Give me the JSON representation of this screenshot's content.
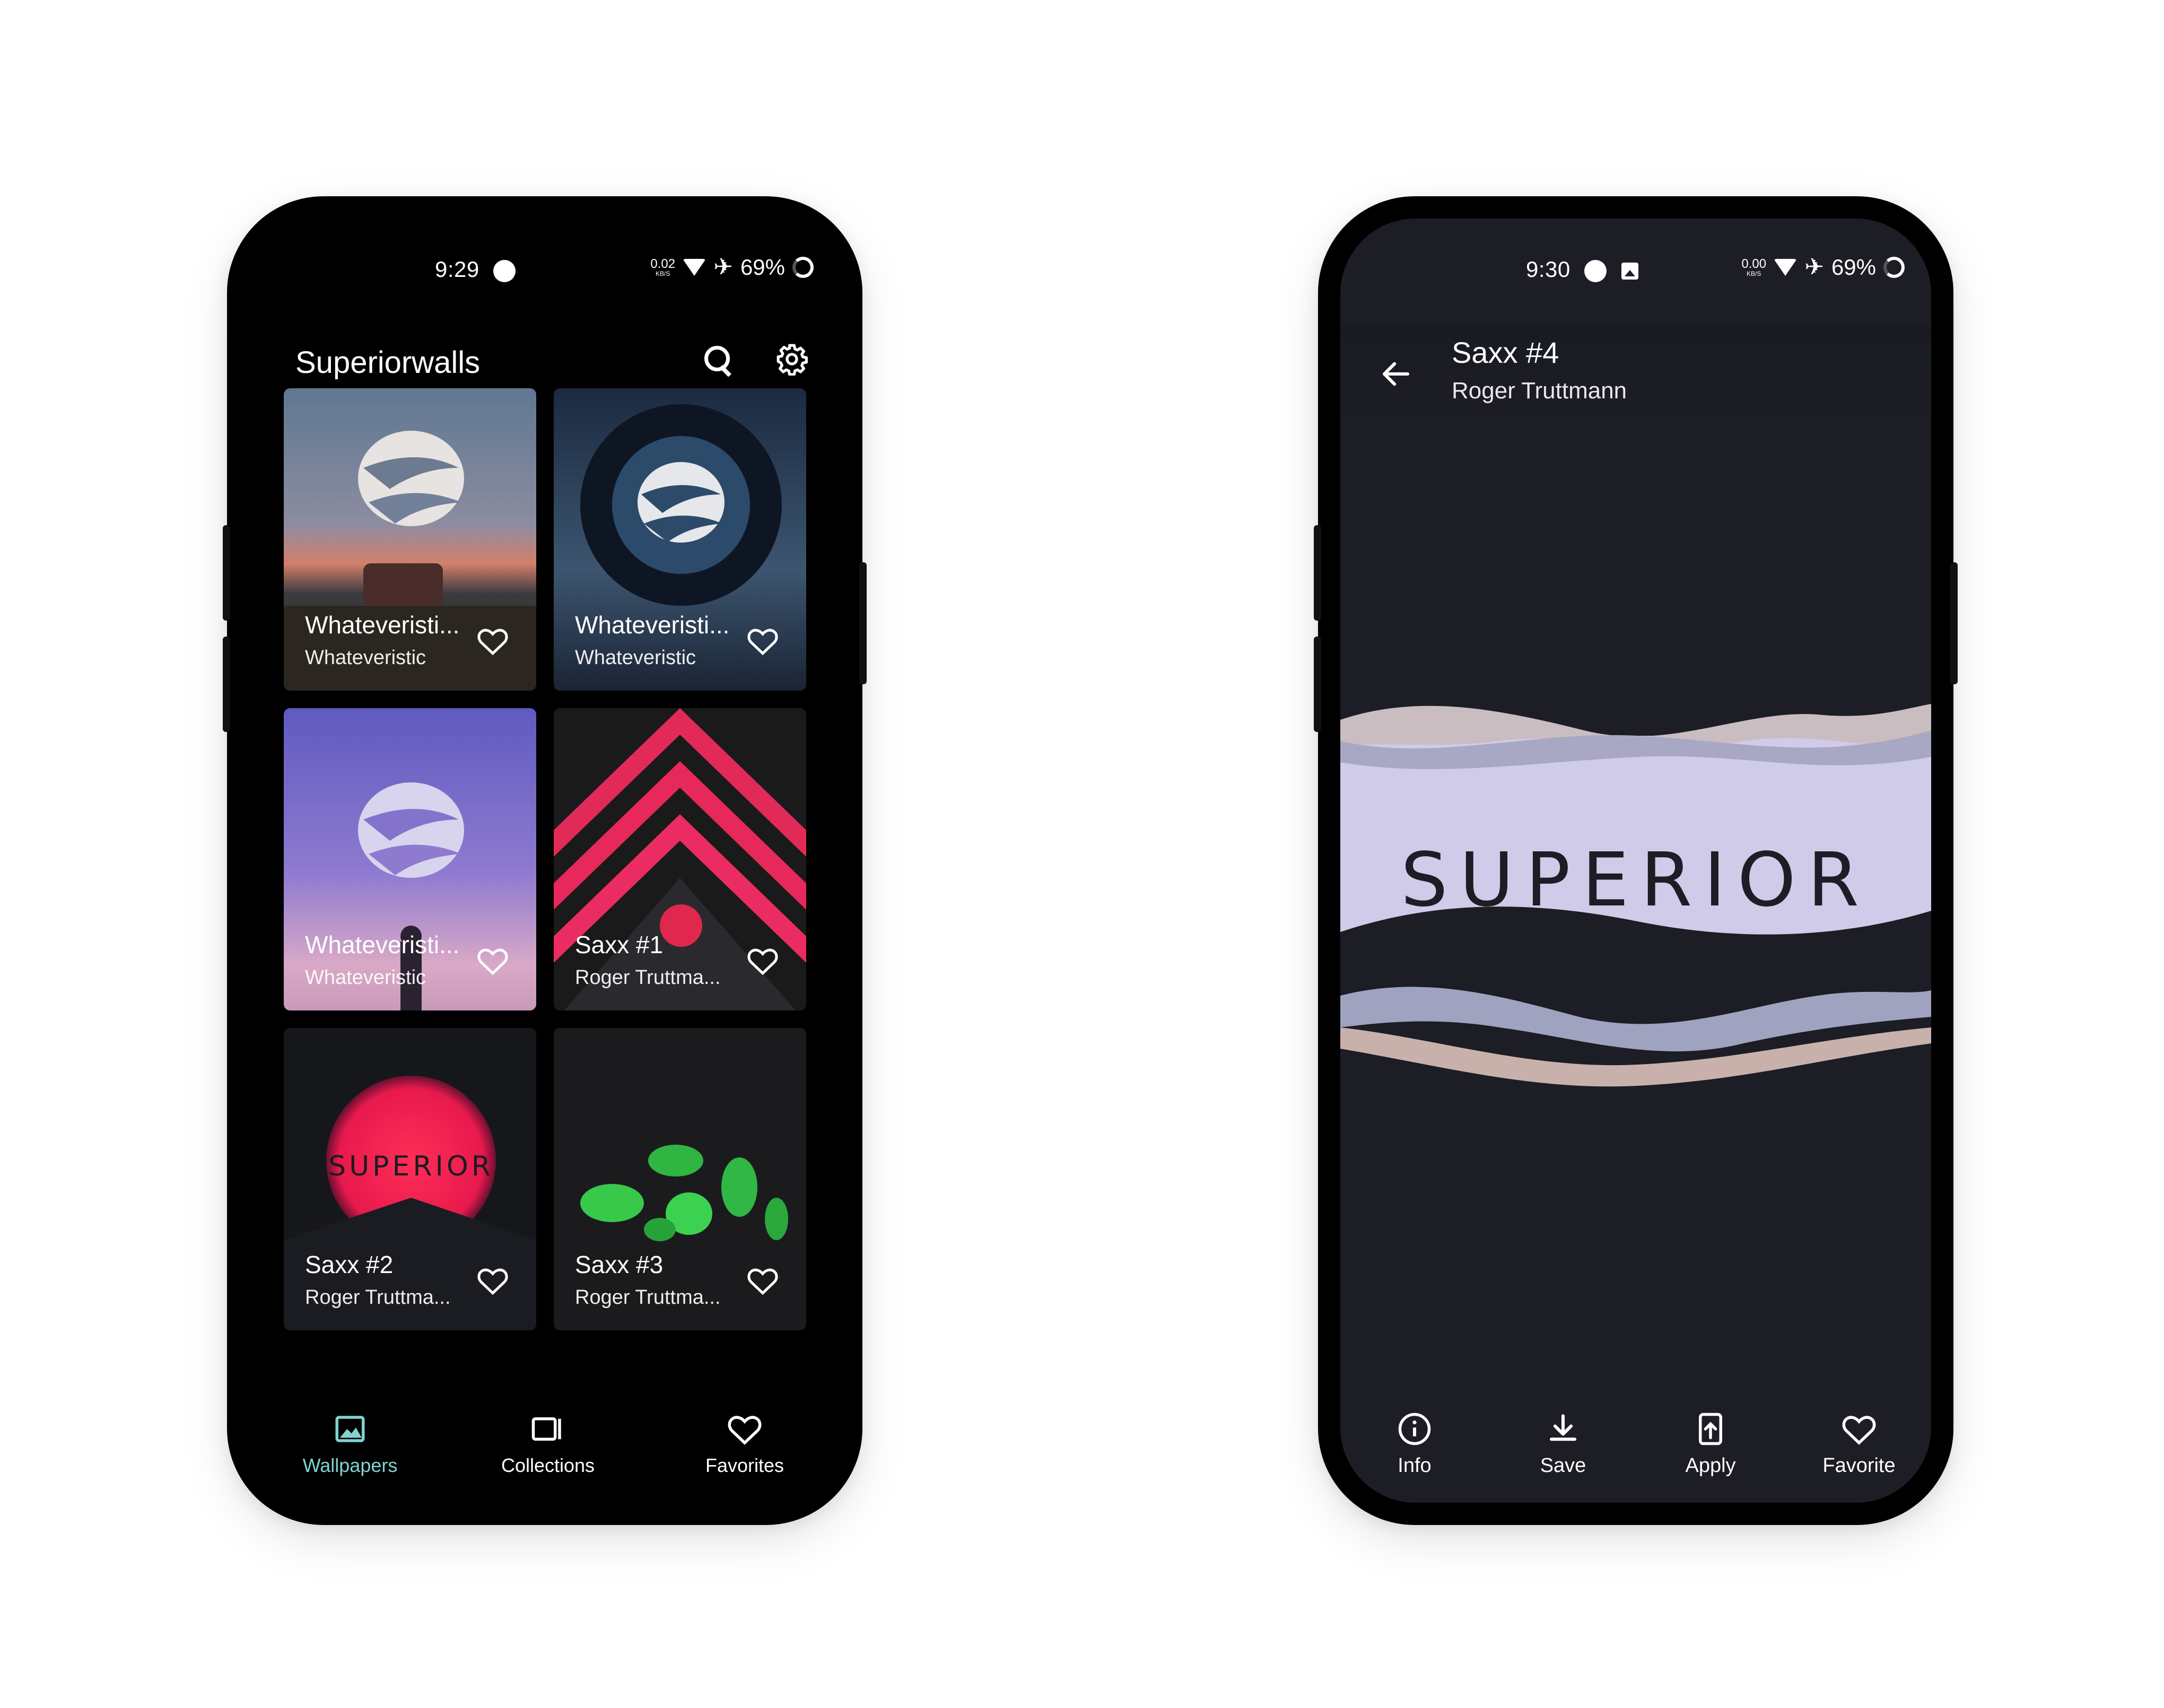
{
  "left_phone": {
    "status": {
      "time": "9:29",
      "speed_value": "0.02",
      "speed_unit": "KB/S",
      "battery": "69%"
    },
    "app_title": "Superiorwalls",
    "tiles": [
      {
        "title": "Whateveristi...",
        "author": "Whateveristic"
      },
      {
        "title": "Whateveristi...",
        "author": "Whateveristic"
      },
      {
        "title": "Whateveristi...",
        "author": "Whateveristic"
      },
      {
        "title": "Saxx #1",
        "author": "Roger Truttma..."
      },
      {
        "title": "Saxx #2",
        "author": "Roger Truttma..."
      },
      {
        "title": "Saxx #3",
        "author": "Roger Truttma..."
      }
    ],
    "tile_logo_text": "SUPERIOR",
    "nav": [
      {
        "label": "Wallpapers",
        "active": true
      },
      {
        "label": "Collections",
        "active": false
      },
      {
        "label": "Favorites",
        "active": false
      }
    ],
    "accent_color": "#7fd3cf"
  },
  "right_phone": {
    "status": {
      "time": "9:30",
      "speed_value": "0.00",
      "speed_unit": "KB/S",
      "battery": "69%"
    },
    "title": "Saxx #4",
    "author": "Roger Truttmann",
    "wallpaper_text": "SUPERIOR",
    "actions": [
      {
        "label": "Info",
        "icon": "info-icon"
      },
      {
        "label": "Save",
        "icon": "download-icon"
      },
      {
        "label": "Apply",
        "icon": "apply-icon"
      },
      {
        "label": "Favorite",
        "icon": "heart-icon"
      }
    ],
    "background_color": "#1c1d25"
  }
}
